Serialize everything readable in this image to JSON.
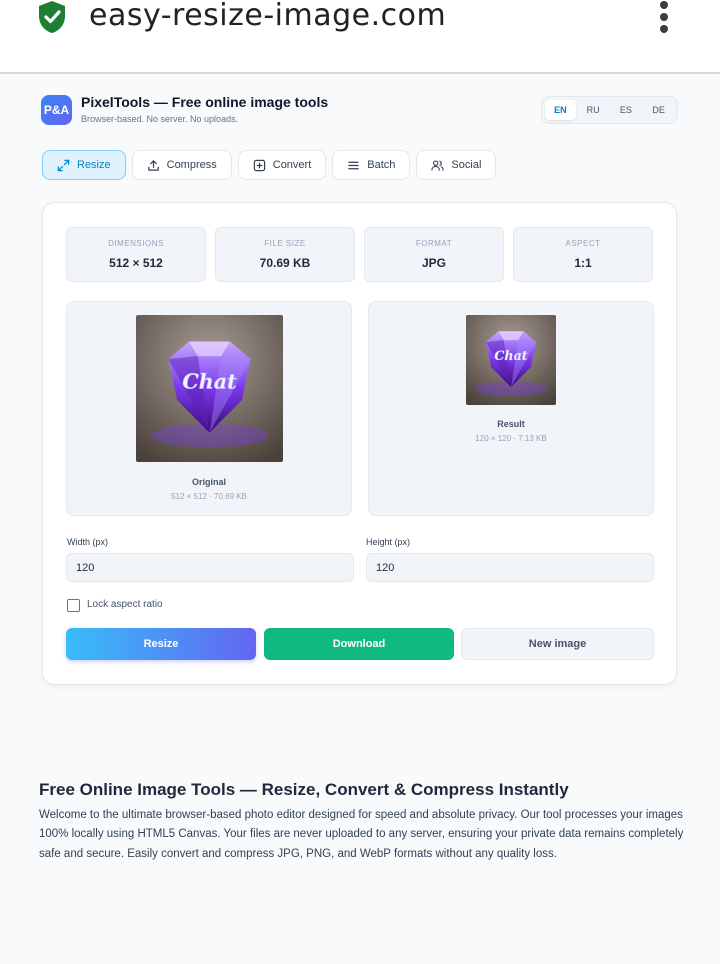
{
  "browser": {
    "url": "easy-resize-image.com",
    "security_icon": "shield-check-icon",
    "menu_icon": "more-vertical-icon"
  },
  "app": {
    "logo_text": "P&A",
    "title": "PixelTools — Free online image tools",
    "subtitle": "Browser-based. No server. No uploads."
  },
  "languages": [
    {
      "label": "EN",
      "active": true
    },
    {
      "label": "RU",
      "active": false
    },
    {
      "label": "ES",
      "active": false
    },
    {
      "label": "DE",
      "active": false
    }
  ],
  "tabs": [
    {
      "label": "Resize",
      "icon": "expand-icon",
      "active": true
    },
    {
      "label": "Compress",
      "icon": "upload-icon",
      "active": false
    },
    {
      "label": "Convert",
      "icon": "plus-square-icon",
      "active": false
    },
    {
      "label": "Batch",
      "icon": "list-icon",
      "active": false
    },
    {
      "label": "Social",
      "icon": "users-icon",
      "active": false
    }
  ],
  "stats": [
    {
      "label": "DIMENSIONS",
      "value": "512 × 512"
    },
    {
      "label": "FILE SIZE",
      "value": "70.69 KB"
    },
    {
      "label": "FORMAT",
      "value": "JPG"
    },
    {
      "label": "ASPECT",
      "value": "1:1"
    }
  ],
  "original": {
    "caption": "Original",
    "meta": "512 × 512 · 70.69 KB",
    "image_text": "Chat"
  },
  "result": {
    "caption": "Result",
    "meta": "120 × 120 · 7.13 KB",
    "image_text": "Chat"
  },
  "width_field": {
    "label": "Width (px)",
    "value": "120"
  },
  "height_field": {
    "label": "Height (px)",
    "value": "120"
  },
  "lock_aspect": {
    "label": "Lock aspect ratio",
    "checked": false
  },
  "buttons": {
    "resize": "Resize",
    "download": "Download",
    "new_image": "New image"
  },
  "seo": {
    "title": "Free Online Image Tools — Resize, Convert & Compress Instantly",
    "body": "Welcome to the ultimate browser-based photo editor designed for speed and absolute privacy. Our tool processes your images 100% locally using HTML5 Canvas. Your files are never uploaded to any server, ensuring your private data remains completely safe and secure. Easily convert and compress JPG, PNG, and WebP formats without any quality loss."
  },
  "colors": {
    "accent": "#0284c7",
    "download_green": "#10b981",
    "gem_purple": "#7c3aed"
  }
}
